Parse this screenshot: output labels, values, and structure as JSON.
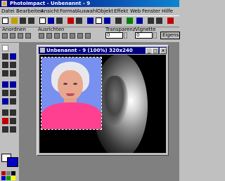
{
  "app": {
    "title": "PhotoImpact - Unbenannt - 9"
  },
  "menu": [
    "Datei",
    "Bearbeiten",
    "Ansicht",
    "Format",
    "Auswahl",
    "Objekt",
    "Effekt",
    "Web",
    "Fenster",
    "Hilfe"
  ],
  "attributes": {
    "anordnen_label": "Anordnen",
    "ausrichten_label": "Ausrichten",
    "transparenz_label": "Transparenz",
    "transparenz_value": "0",
    "vignette_label": "Vignette",
    "vignette_value": "0",
    "effect_button": "Eigenschaften"
  },
  "document": {
    "title": "Unbenannt - 9 (100%) 320x240"
  },
  "colors": {
    "titlebar": "#000080",
    "background_color": "#0000c0",
    "foreground_color": "#ffffff"
  },
  "icons": {
    "toolbar": [
      "new-icon",
      "open-icon",
      "save-icon",
      "print-icon",
      "cut-icon",
      "copy-icon",
      "paste-icon",
      "undo-icon",
      "redo-icon",
      "web-icon",
      "zoom-icon"
    ],
    "tools": [
      "pick-tool-icon",
      "transform-tool-icon",
      "selection-tool-icon",
      "text-tool-icon",
      "fill-tool-icon",
      "brush-tool-icon",
      "stamp-tool-icon",
      "eraser-tool-icon",
      "retouch-tool-icon",
      "path-tool-icon",
      "zoom-tool-icon",
      "eyedropper-tool-icon"
    ]
  }
}
